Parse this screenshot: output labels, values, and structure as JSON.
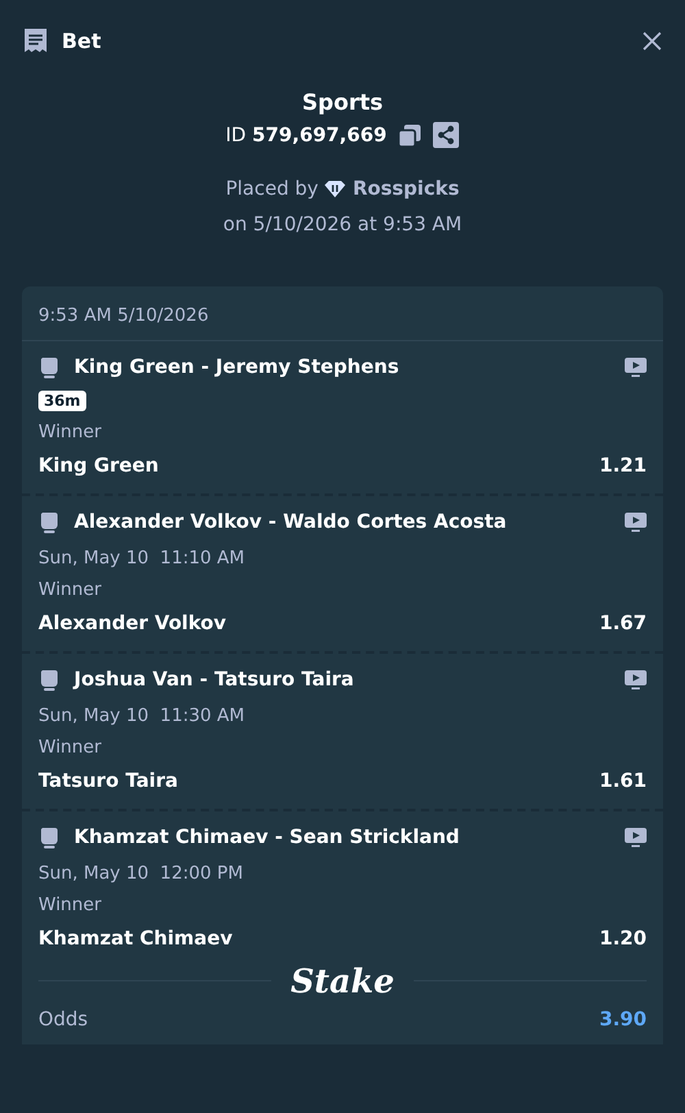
{
  "header": {
    "title": "Bet"
  },
  "summary": {
    "category": "Sports",
    "id_label": "ID",
    "id_value": "579,697,669",
    "placed_by": "Placed by",
    "user": "Rosspicks",
    "placed_on": "on 5/10/2026 at 9:53 AM"
  },
  "slip": {
    "timestamp": "9:53 AM 5/10/2026",
    "matches": [
      {
        "event": "King Green - Jeremy Stephens",
        "badge": "36m",
        "market": "Winner",
        "pick": "King Green",
        "odds": "1.21"
      },
      {
        "event": "Alexander Volkov - Waldo Cortes Acosta",
        "date": "Sun, May 10",
        "time": "11:10 AM",
        "market": "Winner",
        "pick": "Alexander Volkov",
        "odds": "1.67"
      },
      {
        "event": "Joshua Van - Tatsuro Taira",
        "date": "Sun, May 10",
        "time": "11:30 AM",
        "market": "Winner",
        "pick": "Tatsuro Taira",
        "odds": "1.61"
      },
      {
        "event": "Khamzat Chimaev - Sean Strickland",
        "date": "Sun, May 10",
        "time": "12:00 PM",
        "market": "Winner",
        "pick": "Khamzat Chimaev",
        "odds": "1.20"
      }
    ],
    "logo": "Stake",
    "total_label": "Odds",
    "total_odds": "3.90"
  }
}
